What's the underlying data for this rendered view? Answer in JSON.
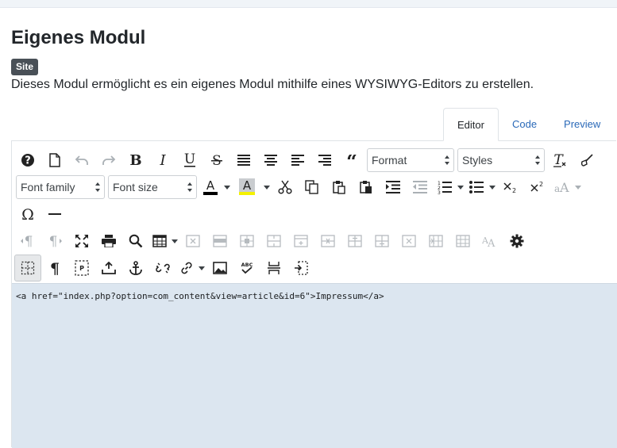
{
  "page": {
    "title": "Eigenes Modul",
    "badge": "Site",
    "description": "Dieses Modul ermöglicht es ein eigenes Modul mithilfe eines WYSIWYG-Editors zu erstellen."
  },
  "tabs": [
    {
      "label": "Editor",
      "active": true
    },
    {
      "label": "Code",
      "active": false
    },
    {
      "label": "Preview",
      "active": false
    }
  ],
  "toolbar": {
    "format_select": "Format",
    "styles_select": "Styles",
    "font_family_select": "Font family",
    "font_size_select": "Font size",
    "text_color_swatch": "#000000",
    "highlight_color_swatch": "#f4f100",
    "row1_icons": [
      "help-icon",
      "new-document-icon",
      "undo-icon",
      "redo-icon",
      "bold-icon",
      "italic-icon",
      "underline-icon",
      "strikethrough-icon",
      "align-justify-icon",
      "align-center-icon",
      "align-left-icon",
      "align-right-icon",
      "blockquote-icon",
      "clear-formatting-icon",
      "paste-as-text-icon"
    ],
    "row2_icons": [
      "text-color-icon",
      "highlight-color-icon",
      "cut-icon",
      "copy-icon",
      "paste-icon",
      "paste-special-icon",
      "indent-icon",
      "outdent-icon",
      "numbered-list-icon",
      "bullet-list-icon",
      "subscript-icon",
      "superscript-icon",
      "font-case-icon"
    ],
    "row3_icons": [
      "special-character-icon",
      "horizontal-rule-icon"
    ],
    "row4_icons": [
      "ltr-icon",
      "rtl-icon",
      "fullscreen-icon",
      "print-icon",
      "search-replace-icon",
      "table-icon",
      "table-delete-icon",
      "row-props-icon",
      "cell-props-icon",
      "merge-cells-icon",
      "split-cell-icon",
      "delete-row-icon",
      "insert-row-before-icon",
      "insert-row-after-icon",
      "delete-column-icon",
      "insert-column-before-icon",
      "insert-column-after-icon",
      "spellcheck-font-icon",
      "settings-icon"
    ],
    "row5_icons": [
      "visual-blocks-icon",
      "paragraph-marks-icon",
      "page-break-icon",
      "upload-icon",
      "anchor-icon",
      "unlink-icon",
      "link-icon",
      "image-icon",
      "spellcheck-icon",
      "insert-row-icon",
      "page-embed-icon"
    ]
  },
  "content": {
    "code": "<a href=\"index.php?option=com_content&view=article&id=6\">Impressum</a>"
  }
}
